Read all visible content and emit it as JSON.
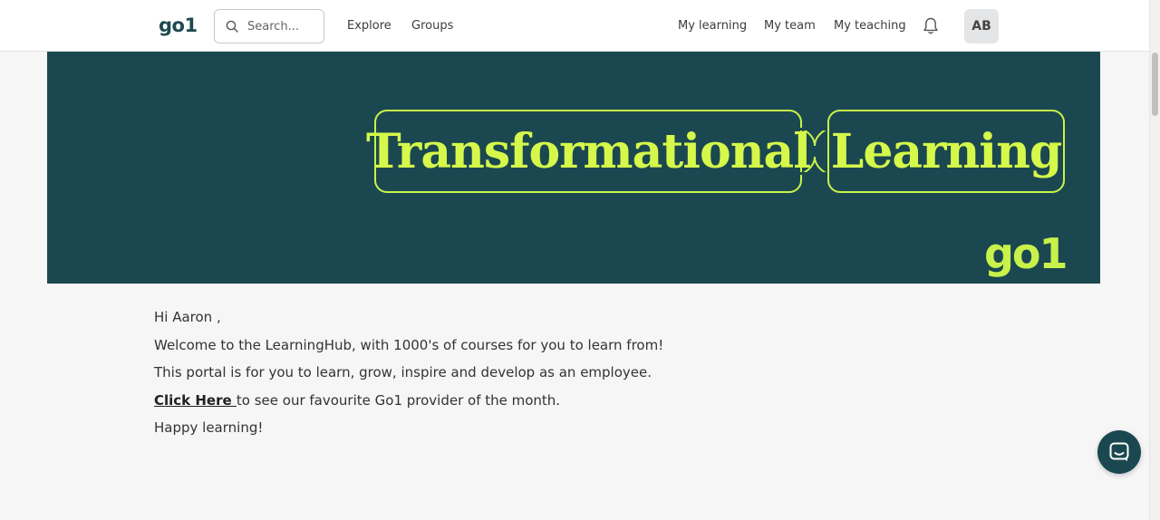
{
  "header": {
    "logo": "go1",
    "search_placeholder": "Search...",
    "nav_left": [
      "Explore",
      "Groups"
    ],
    "nav_right": [
      "My learning",
      "My team",
      "My teaching"
    ],
    "avatar_initials": "AB"
  },
  "banner": {
    "pill_left": "Transformational",
    "pill_right": "Learning",
    "logo": "go1",
    "colors": {
      "background": "#1b4850",
      "accent": "#c8f24a"
    }
  },
  "welcome": {
    "greeting": "Hi Aaron ,",
    "line1": "Welcome to the LearningHub, with 1000's of courses for you to learn from!",
    "line2": "This portal is for you to learn, grow, inspire and develop as an employee.",
    "link_label": "Click Here ",
    "link_suffix": "to see our favourite Go1 provider of the month.",
    "sign_off": "Happy learning!"
  },
  "icons": {
    "search": "search-icon",
    "bell": "bell-icon",
    "chat": "chat-icon"
  }
}
